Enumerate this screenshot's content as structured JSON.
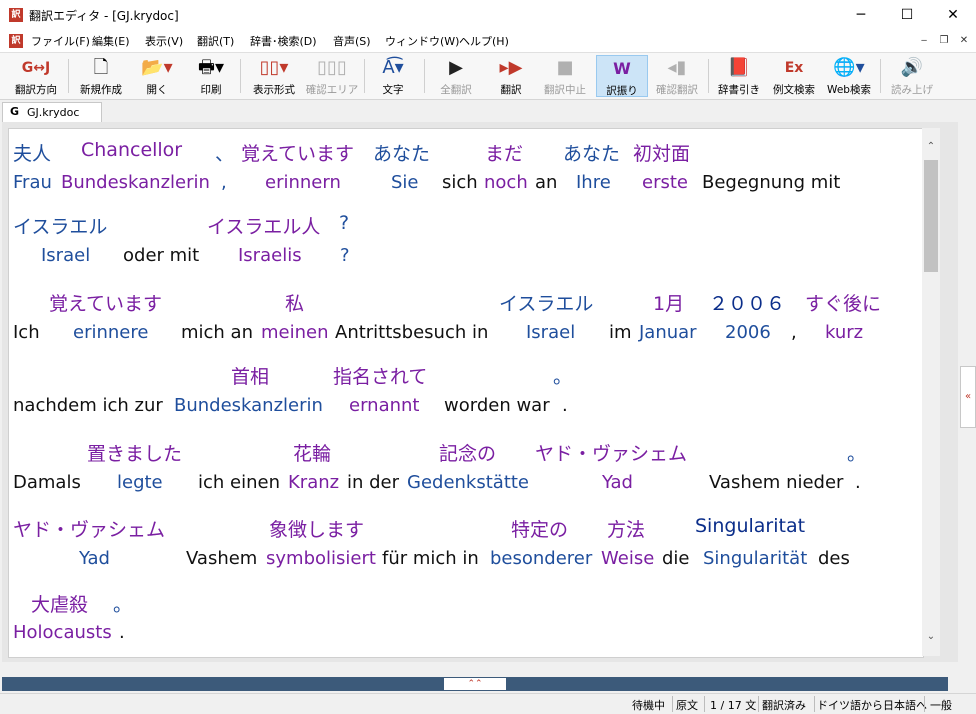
{
  "window": {
    "title": "翻訳エディタ - [GJ.krydoc]",
    "minimize": "─",
    "maximize": "☐",
    "close": "✕"
  },
  "menu": {
    "items": [
      "ファイル(F)",
      "編集(E)",
      "表示(V)",
      "翻訳(T)",
      "辞書･検索(D)",
      "音声(S)",
      "ウィンドウ(W)",
      "ヘルプ(H)"
    ],
    "mdi_minimize": "‒",
    "mdi_restore": "❐",
    "mdi_close": "✕"
  },
  "toolbar": {
    "direction": "翻訳方向",
    "new": "新規作成",
    "open": "開く",
    "print": "印刷",
    "display": "表示形式",
    "confirm_area": "確認エリア",
    "text": "文字",
    "translate_all": "全翻訳",
    "translate": "翻訳",
    "stop": "翻訳中止",
    "assign": "訳振り",
    "confirm_translate": "確認翻訳",
    "dictionary": "辞書引き",
    "example_search": "例文検索",
    "web_search": "Web検索",
    "read_aloud": "読み上げ",
    "direction_icon": "G↔J"
  },
  "tab": {
    "icon": "G",
    "label": "GJ.krydoc"
  },
  "document": {
    "line1_ja": [
      "夫人",
      "Chancellor",
      "、",
      "覚えています",
      "あなた",
      "まだ",
      "あなた",
      "初対面"
    ],
    "line1_de": [
      "Frau",
      "Bundeskanzlerin",
      ",",
      "erinnern",
      "Sie",
      "sich",
      "noch",
      "an",
      "Ihre",
      "erste",
      "Begegnung mit"
    ],
    "line2_ja": [
      "イスラエル",
      "イスラエル人",
      "?"
    ],
    "line2_de": [
      "Israel",
      "oder mit",
      "Israelis",
      "?"
    ],
    "line3_ja": [
      "覚えています",
      "私",
      "イスラエル",
      "1月",
      "２００６",
      "すぐ後に"
    ],
    "line3_de": [
      "Ich",
      "erinnere",
      "mich an",
      "meinen",
      "Antrittsbesuch in",
      "Israel",
      "im",
      "Januar",
      "2006",
      ",",
      "kurz"
    ],
    "line4_ja": [
      "首相",
      "指名されて",
      "。"
    ],
    "line4_de": [
      "nachdem ich zur",
      "Bundeskanzlerin",
      "ernannt",
      "worden war",
      "."
    ],
    "line5_ja": [
      "置きました",
      "花輪",
      "記念の",
      "ヤド・ヴァシェム",
      "。"
    ],
    "line5_de": [
      "Damals",
      "legte",
      "ich einen",
      "Kranz",
      "in der",
      "Gedenkstätte",
      "Yad",
      "Vashem nieder",
      "."
    ],
    "line6_ja": [
      "ヤド・ヴァシェム",
      "象徴します",
      "特定の",
      "方法",
      "Singularitat"
    ],
    "line6_de": [
      "Yad",
      "Vashem",
      "symbolisiert",
      "für mich in",
      "besonderer",
      "Weise",
      "die",
      "Singularität",
      "des"
    ],
    "line7_ja": [
      "大虐殺",
      "。"
    ],
    "line7_de": [
      "Holocausts",
      "."
    ]
  },
  "colors": {
    "blue": "#1f4e9c",
    "purple": "#7a1fa2",
    "navy": "#0b2e8a",
    "black": "#111111"
  },
  "status": {
    "state": "待機中",
    "source": "原文",
    "count": "1 / 17 文",
    "translated": "翻訳済み",
    "direction": "ドイツ語から日本語へ",
    "mode": "一般"
  }
}
